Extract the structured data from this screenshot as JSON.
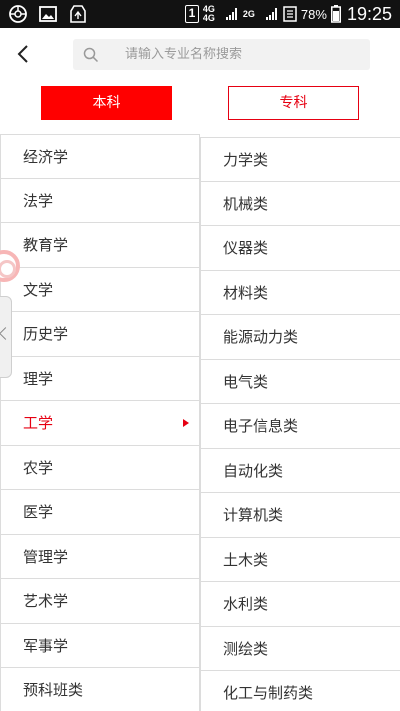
{
  "status_bar": {
    "sim_slot": "1",
    "network_top": "4G",
    "network_bottom": "4G",
    "network_third": "2G",
    "battery": "78%",
    "time": "19:25"
  },
  "header": {
    "back_icon": "chevron-left-icon",
    "search_placeholder": "请输入专业名称搜索"
  },
  "tabs": [
    {
      "label": "本科",
      "selected": true
    },
    {
      "label": "专科",
      "selected": false
    }
  ],
  "colors": {
    "accent": "#e60012",
    "tab_active_bg": "#ff0000",
    "border": "#dcdcdc",
    "search_bg": "#f2f2f2"
  },
  "categories": [
    {
      "label": "经济学"
    },
    {
      "label": "法学"
    },
    {
      "label": "教育学"
    },
    {
      "label": "文学"
    },
    {
      "label": "历史学"
    },
    {
      "label": "理学"
    },
    {
      "label": "工学",
      "active": true
    },
    {
      "label": "农学"
    },
    {
      "label": "医学"
    },
    {
      "label": "管理学"
    },
    {
      "label": "艺术学"
    },
    {
      "label": "军事学"
    },
    {
      "label": "预科班类"
    }
  ],
  "subcategories": [
    {
      "label": "力学类"
    },
    {
      "label": "机械类"
    },
    {
      "label": "仪器类"
    },
    {
      "label": "材料类"
    },
    {
      "label": "能源动力类"
    },
    {
      "label": "电气类"
    },
    {
      "label": "电子信息类"
    },
    {
      "label": "自动化类"
    },
    {
      "label": "计算机类"
    },
    {
      "label": "土木类"
    },
    {
      "label": "水利类"
    },
    {
      "label": "测绘类"
    },
    {
      "label": "化工与制药类"
    }
  ]
}
